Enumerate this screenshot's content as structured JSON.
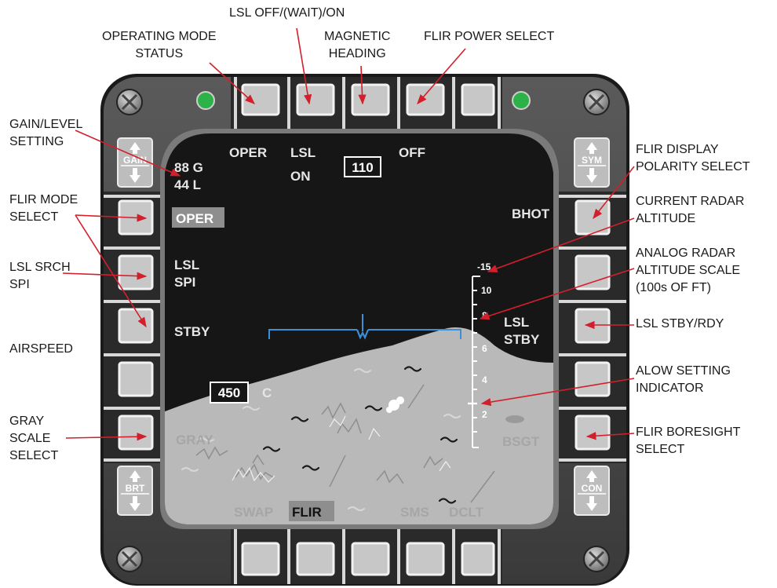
{
  "callouts": {
    "lsl_off_wait_on": "LSL OFF/(WAIT)/ON",
    "operating_mode_status": [
      "OPERATING MODE",
      "STATUS"
    ],
    "magnetic_heading": [
      "MAGNETIC",
      "HEADING"
    ],
    "flir_power_select": "FLIR POWER SELECT",
    "gain_level_setting": [
      "GAIN/LEVEL",
      "SETTING"
    ],
    "flir_mode_select": [
      "FLIR MODE",
      "SELECT"
    ],
    "lsl_srch_spi": [
      "LSL SRCH",
      "SPI"
    ],
    "airspeed": "AIRSPEED",
    "gray_scale_select": [
      "GRAY",
      "SCALE",
      "SELECT"
    ],
    "flir_display_polarity_select": [
      "FLIR DISPLAY",
      "POLARITY SELECT"
    ],
    "current_radar_altitude": [
      "CURRENT RADAR",
      "ALTITUDE"
    ],
    "analog_radar_altitude_scale": [
      "ANALOG RADAR",
      "ALTITUDE SCALE",
      "(100s OF FT)"
    ],
    "lsl_stby_rdy": "LSL STBY/RDY",
    "alow_setting_indicator": [
      "ALOW SETTING",
      "INDICATOR"
    ],
    "flir_boresight_select": [
      "FLIR BORESIGHT",
      "SELECT"
    ]
  },
  "display": {
    "oper_top": "OPER",
    "lsl_top": "LSL",
    "lsl_on": "ON",
    "heading": "110",
    "off": "OFF",
    "gain": "88 G",
    "level": "44 L",
    "oper_side": "OPER",
    "lsl_side": "LSL",
    "spi_side": "SPI",
    "stby_side": "STBY",
    "bhot": "BHOT",
    "lsl_right": "LSL",
    "stby_right": "STBY",
    "airspeed": "450",
    "airspeed_suffix": "C",
    "gray": "GRAY",
    "bsgt": "BSGT",
    "swap": "SWAP",
    "flir": "FLIR",
    "sms": "SMS",
    "dclt": "DCLT"
  },
  "altitude_scale": {
    "ticks": [
      "-15",
      "10",
      "8",
      "6",
      "4",
      "2"
    ],
    "current_altitude_label": "-15"
  },
  "rockers": {
    "gain": "GAIN",
    "sym": "SYM",
    "brt": "BRT",
    "con": "CON"
  },
  "colors": {
    "bezel": "#4a4a4a",
    "screen_sky": "#161616",
    "terrain": "#b9b9b9",
    "display_text": "#e6e6e6",
    "boresight": "#3a8fd6",
    "indicator_light": "#2db24a",
    "callout_arrow": "#d21f2b"
  }
}
